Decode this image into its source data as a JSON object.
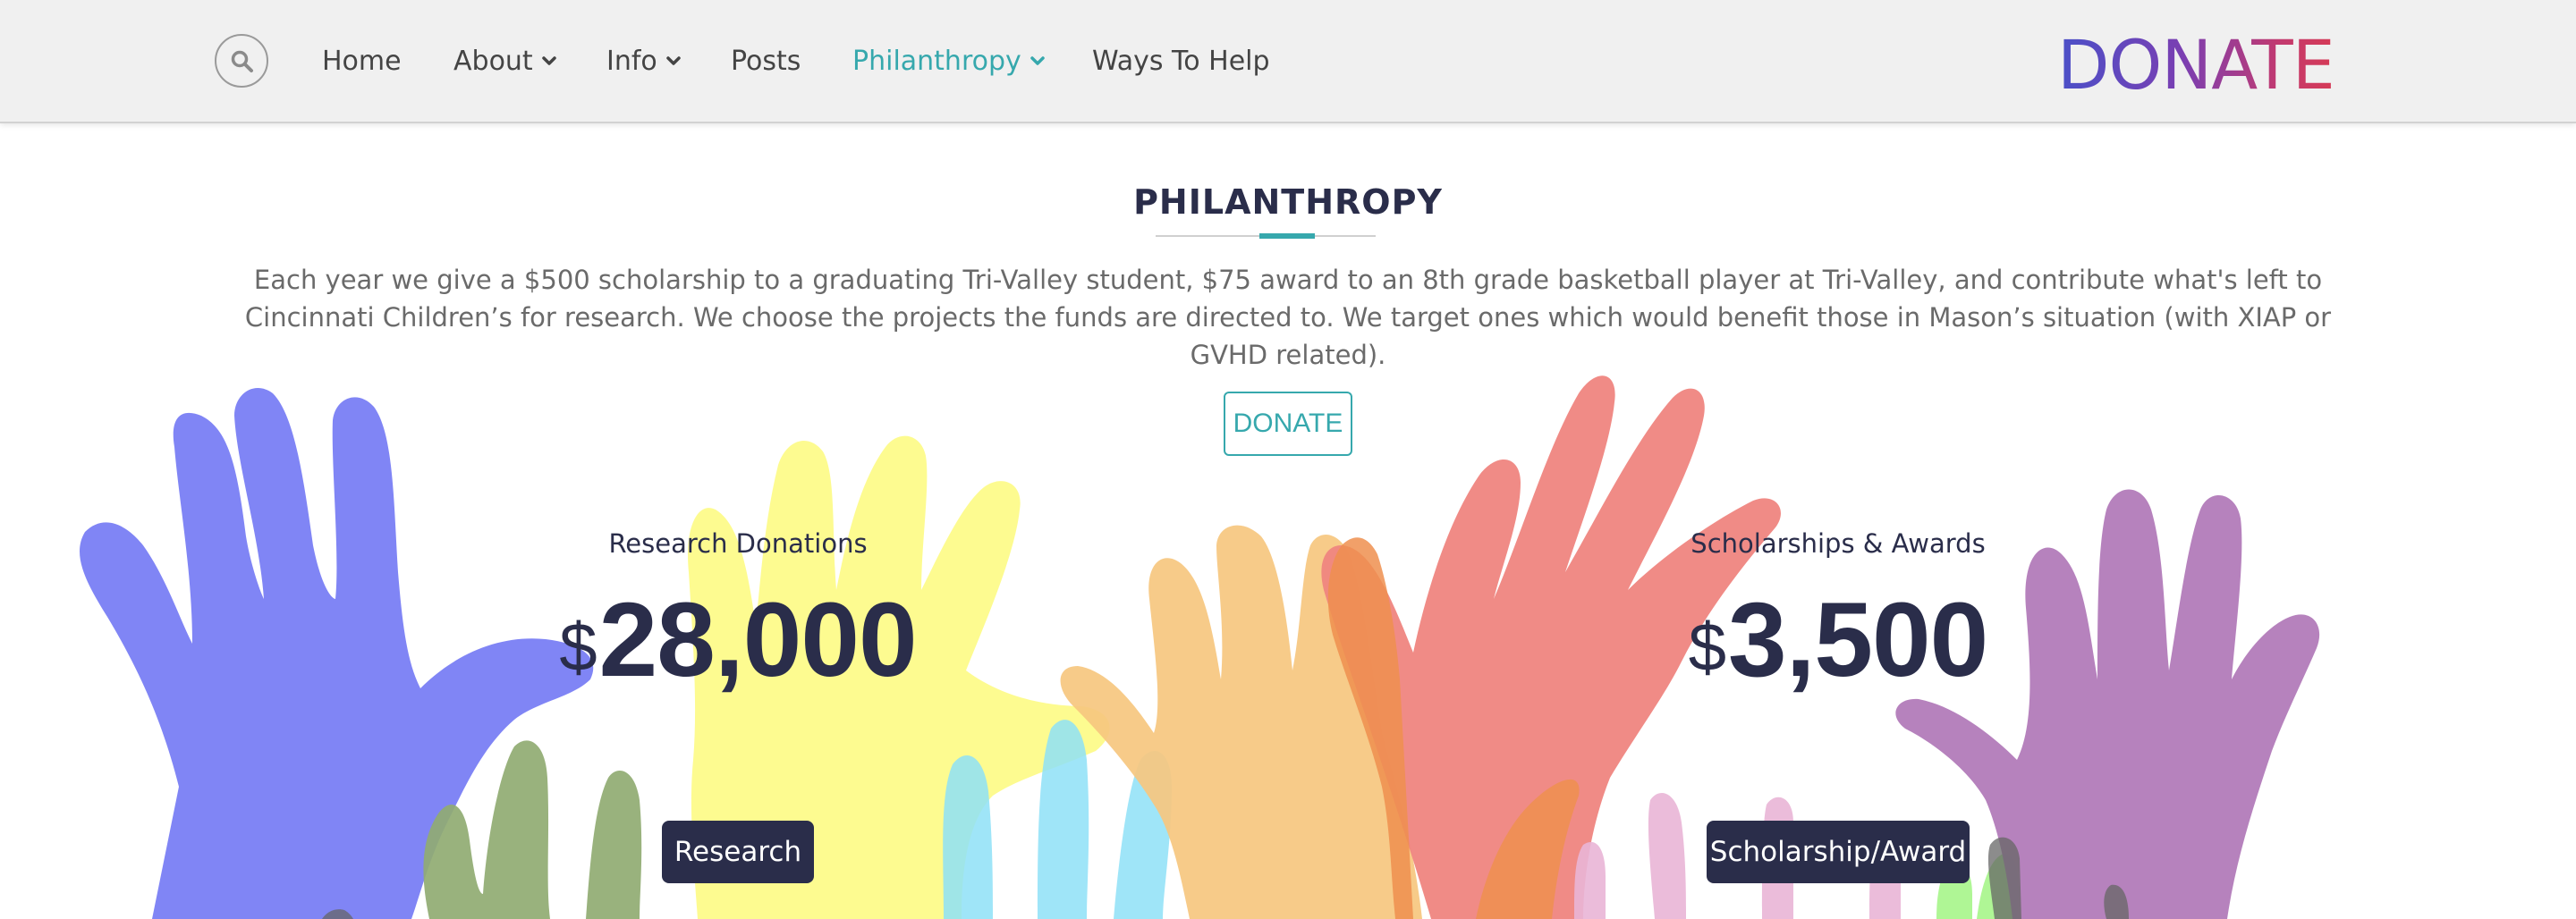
{
  "nav": {
    "items": [
      {
        "label": "Home",
        "dropdown": false,
        "active": false
      },
      {
        "label": "About",
        "dropdown": true,
        "active": false
      },
      {
        "label": "Info",
        "dropdown": true,
        "active": false
      },
      {
        "label": "Posts",
        "dropdown": false,
        "active": false
      },
      {
        "label": "Philanthropy",
        "dropdown": true,
        "active": true
      },
      {
        "label": "Ways To Help",
        "dropdown": false,
        "active": false
      }
    ],
    "logo_text": "DONATE",
    "search_icon": "search-icon"
  },
  "section": {
    "title": "PHILANTHROPY",
    "intro": "Each year we give a $500 scholarship to a graduating Tri-Valley student, $75 award to an 8th grade basketball player at Tri-Valley, and contribute what's left to Cincinnati Children’s for research. We choose the projects the funds are directed to. We target ones which would benefit those in Mason’s situation (with XIAP or GVHD related).",
    "donate_button": "DONATE"
  },
  "stats": [
    {
      "label": "Research Donations",
      "currency": "$",
      "amount": "28,000",
      "button": "Research"
    },
    {
      "label": "Scholarships & Awards",
      "currency": "$",
      "amount": "3,500",
      "button": "Scholarship/Award"
    }
  ],
  "colors": {
    "accent": "#36a8ad",
    "navy": "#2a2d4a",
    "hand_blue": "#7d83f5",
    "hand_yellow": "#fdfb8a",
    "hand_orange": "#f6c77f",
    "hand_red": "#ef8580",
    "hand_purple": "#b57fbc",
    "hand_green": "#90ab72",
    "hand_cyan": "#8ee0f7",
    "hand_pink": "#e9b5d6",
    "hand_lime": "#a6f58a"
  }
}
